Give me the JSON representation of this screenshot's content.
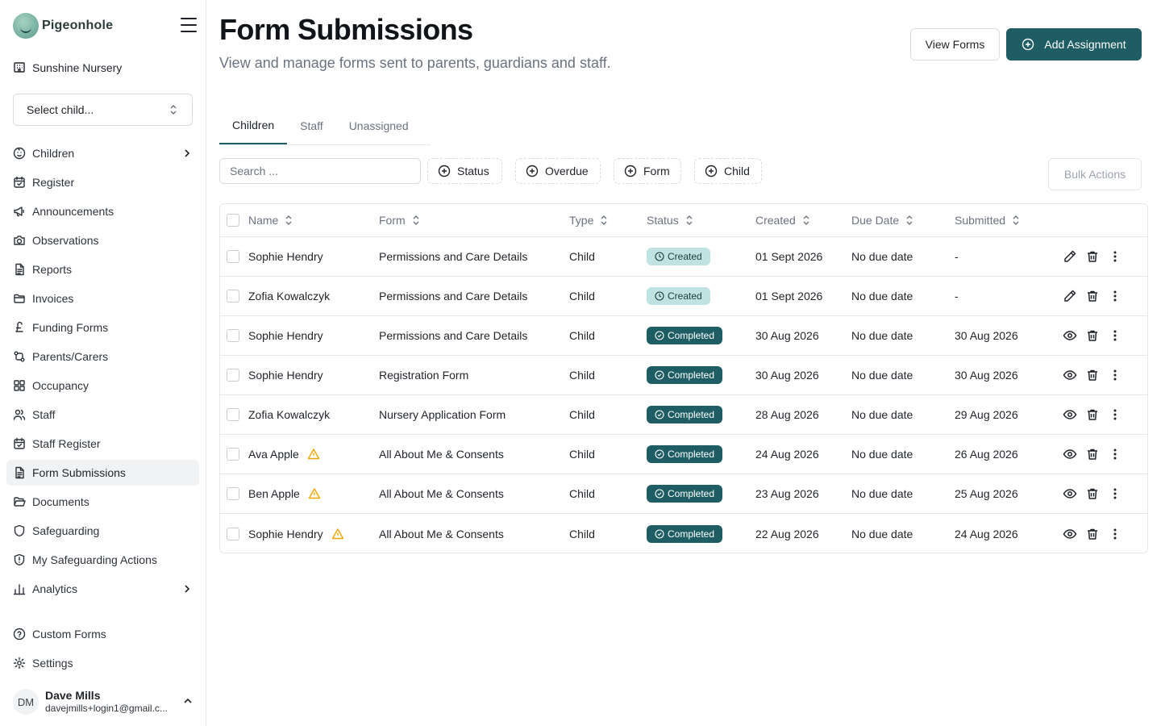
{
  "app": {
    "name": "Pigeonhole",
    "nursery": "Sunshine Nursery",
    "child_select": "Select child..."
  },
  "sidebar": {
    "items": [
      {
        "label": "Children",
        "icon": "baby-face-icon",
        "chevron": true
      },
      {
        "label": "Register",
        "icon": "calendar-check-icon"
      },
      {
        "label": "Announcements",
        "icon": "megaphone-icon"
      },
      {
        "label": "Observations",
        "icon": "camera-icon"
      },
      {
        "label": "Reports",
        "icon": "document-icon"
      },
      {
        "label": "Invoices",
        "icon": "folder-icon"
      },
      {
        "label": "Funding Forms",
        "icon": "pound-icon"
      },
      {
        "label": "Parents/Carers",
        "icon": "git-compare-icon"
      },
      {
        "label": "Occupancy",
        "icon": "grid-icon"
      },
      {
        "label": "Staff",
        "icon": "users-icon"
      },
      {
        "label": "Staff Register",
        "icon": "calendar-check-icon"
      },
      {
        "label": "Form Submissions",
        "icon": "document-icon",
        "active": true
      },
      {
        "label": "Documents",
        "icon": "folder-open-icon"
      },
      {
        "label": "Safeguarding",
        "icon": "shield-icon"
      },
      {
        "label": "My Safeguarding Actions",
        "icon": "shield-alert-icon"
      },
      {
        "label": "Analytics",
        "icon": "bar-chart-icon",
        "chevron": true
      }
    ],
    "bottom_items": [
      {
        "label": "Custom Forms",
        "icon": "help-circle-icon"
      },
      {
        "label": "Settings",
        "icon": "gear-icon"
      }
    ],
    "user": {
      "initials": "DM",
      "name": "Dave Mills",
      "email": "davejmills+login1@gmail.c..."
    }
  },
  "header": {
    "title": "Form Submissions",
    "subtitle": "View and manage forms sent to parents, guardians and staff.",
    "view_forms": "View Forms",
    "add_assignment": "Add Assignment"
  },
  "tabs": [
    "Children",
    "Staff",
    "Unassigned"
  ],
  "filters": {
    "search_placeholder": "Search ...",
    "buttons": [
      "Status",
      "Overdue",
      "Form",
      "Child"
    ],
    "bulk_actions": "Bulk Actions"
  },
  "table": {
    "columns": [
      "Name",
      "Form",
      "Type",
      "Status",
      "Created",
      "Due Date",
      "Submitted"
    ],
    "rows": [
      {
        "name": "Sophie Hendry",
        "warn": false,
        "form": "Permissions and Care Details",
        "type": "Child",
        "status": "Created",
        "created": "01 Sept 2026",
        "due": "No due date",
        "submitted": "-",
        "edit": true
      },
      {
        "name": "Zofia Kowalczyk",
        "warn": false,
        "form": "Permissions and Care Details",
        "type": "Child",
        "status": "Created",
        "created": "01 Sept 2026",
        "due": "No due date",
        "submitted": "-",
        "edit": true
      },
      {
        "name": "Sophie Hendry",
        "warn": false,
        "form": "Permissions and Care Details",
        "type": "Child",
        "status": "Completed",
        "created": "30 Aug 2026",
        "due": "No due date",
        "submitted": "30 Aug 2026",
        "edit": false
      },
      {
        "name": "Sophie Hendry",
        "warn": false,
        "form": "Registration Form",
        "type": "Child",
        "status": "Completed",
        "created": "30 Aug 2026",
        "due": "No due date",
        "submitted": "30 Aug 2026",
        "edit": false
      },
      {
        "name": "Zofia Kowalczyk",
        "warn": false,
        "form": "Nursery Application Form",
        "type": "Child",
        "status": "Completed",
        "created": "28 Aug 2026",
        "due": "No due date",
        "submitted": "29 Aug 2026",
        "edit": false
      },
      {
        "name": "Ava Apple",
        "warn": true,
        "form": "All About Me & Consents",
        "type": "Child",
        "status": "Completed",
        "created": "24 Aug 2026",
        "due": "No due date",
        "submitted": "26 Aug 2026",
        "edit": false
      },
      {
        "name": "Ben Apple",
        "warn": true,
        "form": "All About Me & Consents",
        "type": "Child",
        "status": "Completed",
        "created": "23 Aug 2026",
        "due": "No due date",
        "submitted": "25 Aug 2026",
        "edit": false
      },
      {
        "name": "Sophie Hendry",
        "warn": true,
        "form": "All About Me & Consents",
        "type": "Child",
        "status": "Completed",
        "created": "22 Aug 2026",
        "due": "No due date",
        "submitted": "24 Aug 2026",
        "edit": false
      }
    ]
  },
  "colors": {
    "primary": "#1d5d63",
    "created_badge": "#bfe3e3",
    "warning": "#f0a500"
  }
}
